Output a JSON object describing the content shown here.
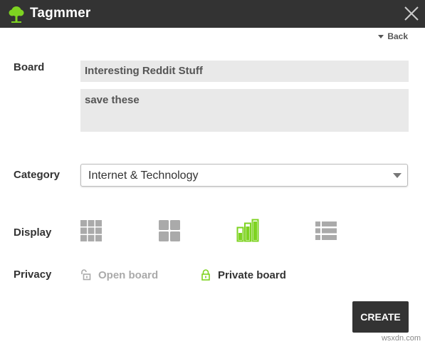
{
  "header": {
    "app_title": "Tagmmer",
    "logo_icon": "tree-icon",
    "close_icon": "close-icon"
  },
  "back": {
    "label": "Back"
  },
  "form": {
    "board_label": "Board",
    "board_name_value": "Interesting Reddit Stuff",
    "board_description_value": "save these",
    "category_label": "Category",
    "category_value": "Internet & Technology",
    "display_label": "Display",
    "display_options": [
      {
        "name": "small-grid-icon",
        "selected": false
      },
      {
        "name": "large-grid-icon",
        "selected": false
      },
      {
        "name": "columns-icon",
        "selected": true
      },
      {
        "name": "list-icon",
        "selected": false
      }
    ],
    "privacy_label": "Privacy",
    "privacy_open_label": "Open board",
    "privacy_private_label": "Private board",
    "privacy_selected": "private",
    "create_label": "CREATE"
  },
  "colors": {
    "titlebar": "#333333",
    "accent_green": "#7ed321",
    "icon_gray": "#aaaaaa",
    "input_bg": "#e9e9e9"
  },
  "watermark": "wsxdn.com"
}
